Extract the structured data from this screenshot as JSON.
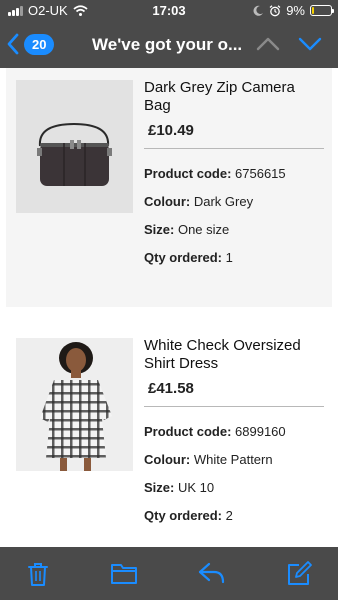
{
  "status": {
    "carrier": "O2-UK",
    "time": "17:03",
    "battery": "9%",
    "battery_level": 0.09,
    "battery_color": "#f5d000"
  },
  "nav": {
    "count": "20",
    "title": "We've got your o..."
  },
  "accent": "#1a8cff",
  "products": [
    {
      "name": "Dark Grey Zip Camera Bag",
      "price": "£10.49",
      "code_label": "Product code:",
      "code": "6756615",
      "colour_label": "Colour:",
      "colour": "Dark Grey",
      "size_label": "Size:",
      "size": "One size",
      "qty_label": "Qty ordered:",
      "qty": "1"
    },
    {
      "name": "White Check Oversized Shirt Dress",
      "price": "£41.58",
      "code_label": "Product code:",
      "code": "6899160",
      "colour_label": "Colour:",
      "colour": "White Pattern",
      "size_label": "Size:",
      "size": "UK 10",
      "qty_label": "Qty ordered:",
      "qty": "2"
    }
  ],
  "toolbar": [
    "trash-icon",
    "folder-icon",
    "reply-icon",
    "compose-icon"
  ]
}
